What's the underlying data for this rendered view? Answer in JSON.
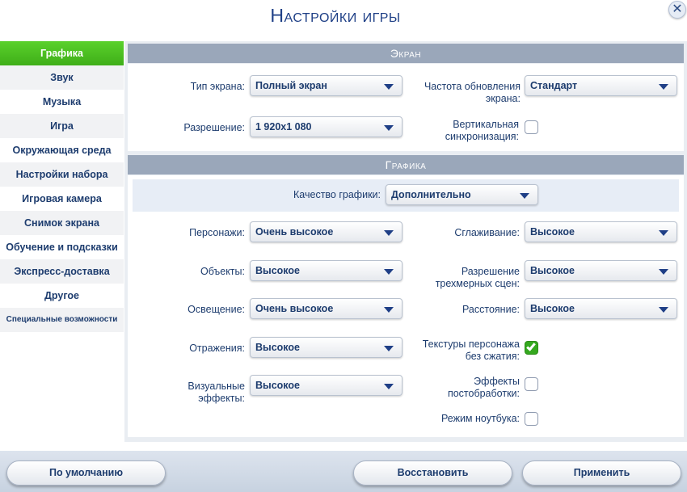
{
  "window": {
    "title": "Настройки игры",
    "close_glyph": "✕"
  },
  "sidebar": {
    "items": [
      {
        "label": "Графика"
      },
      {
        "label": "Звук"
      },
      {
        "label": "Музыка"
      },
      {
        "label": "Игра"
      },
      {
        "label": "Окружающая среда"
      },
      {
        "label": "Настройки набора"
      },
      {
        "label": "Игровая камера"
      },
      {
        "label": "Снимок экрана"
      },
      {
        "label": "Обучение и подсказки"
      },
      {
        "label": "Экспресс-доставка"
      },
      {
        "label": "Другое"
      },
      {
        "label": "Специальные возможности"
      }
    ],
    "active_index": 0
  },
  "screen": {
    "header": "Экран",
    "type_label": "Тип экрана:",
    "type_value": "Полный экран",
    "refresh_label": "Частота обновления экрана:",
    "refresh_value": "Стандарт",
    "resolution_label": "Разрешение:",
    "resolution_value": "1 920x1 080",
    "vsync_label": "Вертикальная синхронизация:",
    "vsync_checked": false
  },
  "graphics": {
    "header": "Графика",
    "quality_label": "Качество графики:",
    "quality_value": "Дополнительно",
    "sims_label": "Персонажи:",
    "sims_value": "Очень высокое",
    "objects_label": "Объекты:",
    "objects_value": "Высокое",
    "lighting_label": "Освещение:",
    "lighting_value": "Очень высокое",
    "reflections_label": "Отражения:",
    "reflections_value": "Высокое",
    "vfx_label": "Визуальные эффекты:",
    "vfx_value": "Высокое",
    "aa_label": "Сглаживание:",
    "aa_value": "Высокое",
    "scene_res_label": "Разрешение трехмерных сцен:",
    "scene_res_value": "Высокое",
    "distance_label": "Расстояние:",
    "distance_value": "Высокое",
    "uncompressed_label": "Текстуры персонажа без сжатия:",
    "uncompressed_checked": true,
    "postfx_label": "Эффекты постобработки:",
    "postfx_checked": false,
    "laptop_label": "Режим ноутбука:",
    "laptop_checked": false
  },
  "footer": {
    "defaults_label": "По умолчанию",
    "restore_label": "Восстановить",
    "apply_label": "Применить"
  },
  "colors": {
    "active_tab": "#4cc021",
    "section_header": "#9aa7ba",
    "text": "#1d3c6e",
    "checkbox_on": "#35a81f"
  }
}
